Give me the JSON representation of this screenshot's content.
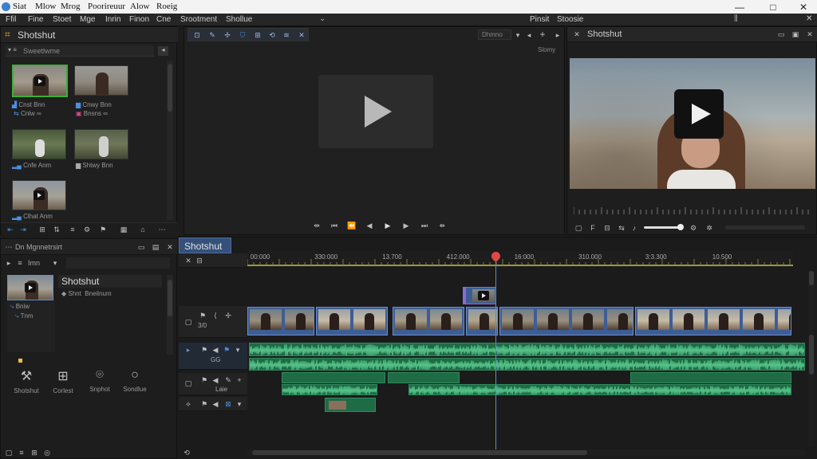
{
  "titlebar": {
    "menus": [
      "Siat",
      "Mlow",
      "Mrog",
      "Poorireuur",
      "Alow",
      "Roeig"
    ],
    "controls": [
      "—",
      "□",
      "✕"
    ]
  },
  "menubar": {
    "items": [
      "Ffil",
      "Fine",
      "Stoet",
      "Mge",
      "Inrin",
      "Finon",
      "Cne",
      "Srootment",
      "Shollue"
    ],
    "right_items": [
      "Pinsit",
      "Stoosie"
    ]
  },
  "app": {
    "name": "Shotshut"
  },
  "media_bin": {
    "search_label": "Sweetlwme",
    "items": [
      {
        "caption": "Cnst Bnn",
        "sub": "Cnlw  ∞"
      },
      {
        "caption": "Cnwy Bnn",
        "sub": "Bnsns  ∞"
      },
      {
        "caption": "Cnfe Anm",
        "sub": ""
      },
      {
        "caption": "Shtwy Bnn",
        "sub": ""
      },
      {
        "caption": "Clhat Anm",
        "sub": ""
      }
    ]
  },
  "project_panel": {
    "title": "Dn Mgnnetrsirt",
    "sub_label": "Imn",
    "clip_name": "Shotshut",
    "clip_meta": [
      "Shnt",
      "Bneilnum"
    ],
    "clip_sub": [
      "Bniw",
      "Tnm"
    ],
    "tools": [
      "Shotshut",
      "Corlest",
      "Snphot",
      "Sondlue"
    ]
  },
  "viewer": {
    "zoom_label": "Dhmno",
    "side_label": "Slomy"
  },
  "preview": {
    "title": "Shotshut"
  },
  "timeline": {
    "tab": "Shotshut",
    "ruler": [
      "00:000",
      "330:000",
      "13.700",
      "412.000",
      "16:000",
      "310.000",
      "3:3.300",
      "10.500"
    ],
    "track_labels": [
      "3/0",
      "GG",
      "Laie"
    ],
    "playhead_percent": 45.5
  },
  "colors": {
    "accent": "#3fae3a",
    "video_clip": "#3e5d94",
    "audio_clip": "#1f6b46",
    "playhead": "#e04848",
    "ruler_line": "#c8c24a"
  }
}
